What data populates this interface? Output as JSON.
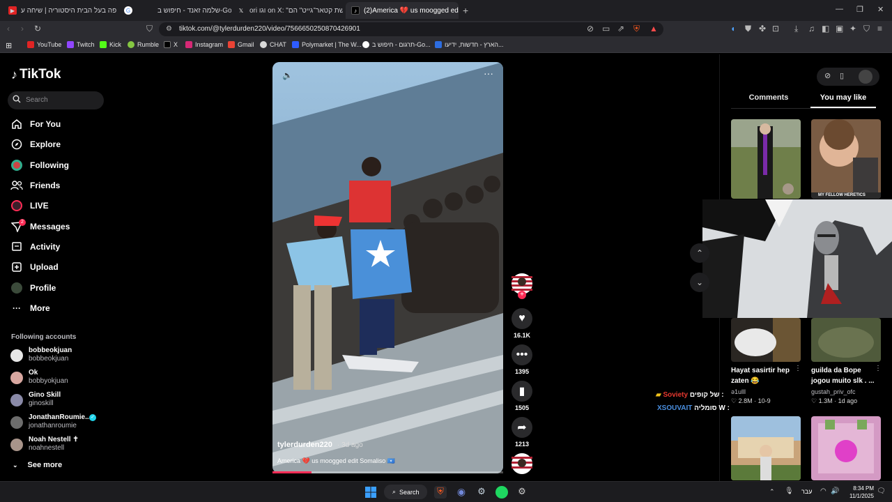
{
  "browser": {
    "tabs": [
      {
        "title": "מי פה בעל הבית היסטוריה | שיחה ע",
        "active": false
      },
      {
        "title": "שלמה זאנד - חיפוש ב-Google",
        "active": false
      },
      {
        "title": "ori וגו on X: \"פרשת קטאר־גייט\" הם",
        "active": false
      },
      {
        "title": "(2)America 💔 us moogged edit",
        "active": true
      }
    ],
    "url": "tiktok.com/@tylerdurden220/video/7566650250870426901",
    "bookmarks": [
      "YouTube",
      "Twitch",
      "Kick",
      "Rumble",
      "X",
      "Instagram",
      "Gmail",
      "CHAT",
      "Polymarket | The W...",
      "תרגום - חיפוש ב-Go...",
      "הארץ - חדשות, ידיעו..."
    ]
  },
  "tiktok": {
    "logo": "TikTok",
    "search_placeholder": "Search",
    "nav": [
      "For You",
      "Explore",
      "Following",
      "Friends",
      "LIVE",
      "Messages",
      "Activity",
      "Upload",
      "Profile",
      "More"
    ],
    "messages_badge": "2",
    "following_title": "Following accounts",
    "accounts": [
      {
        "name": "bobbeokjuan",
        "handle": "bobbeokjuan",
        "color": "#e7e7e7"
      },
      {
        "name": "Ok",
        "handle": "bobbyokjuan",
        "color": "#d8a7a0"
      },
      {
        "name": "Gino Skill",
        "handle": "ginoskill",
        "color": "#8a8aa8"
      },
      {
        "name": "JonathanRoumie...",
        "handle": "jonathanroumie",
        "color": "#6d6d6d"
      },
      {
        "name": "Noah Nestell ✝",
        "handle": "noahnestell",
        "color": "#a8948a"
      }
    ],
    "see_more": "See more"
  },
  "video": {
    "username": "tylerdurden220",
    "date": "· 3d ago",
    "caption": "America 💔 us moogged edit Somaliso 🇸🇴",
    "progress": 0.17,
    "likes": "16.1K",
    "comments": "1395",
    "saves": "1505",
    "shares": "1213"
  },
  "right_panel": {
    "tab_comments": "Comments",
    "tab_you_may_like": "You may like",
    "videos": [
      {
        "title": "Hayat sasirtir hep zaten 😂",
        "author": "ə1ulll",
        "views": "2.8M",
        "date": "10-9"
      },
      {
        "title": "guilda da Bope jogou muito slk . ...",
        "author": "gustah_priv_ofc",
        "views": "1.3M",
        "date": "1d ago"
      }
    ],
    "thumb_caption": "MY FELLOW HERETICS"
  },
  "chat": [
    {
      "user": "Soviety",
      "text": "של קופים :"
    },
    {
      "user": "XSOUVAIT",
      "text": "סומליה W :"
    }
  ],
  "taskbar": {
    "search": "Search",
    "lang": "עבר",
    "time": "8:34 PM",
    "date": "11/1/2025"
  }
}
